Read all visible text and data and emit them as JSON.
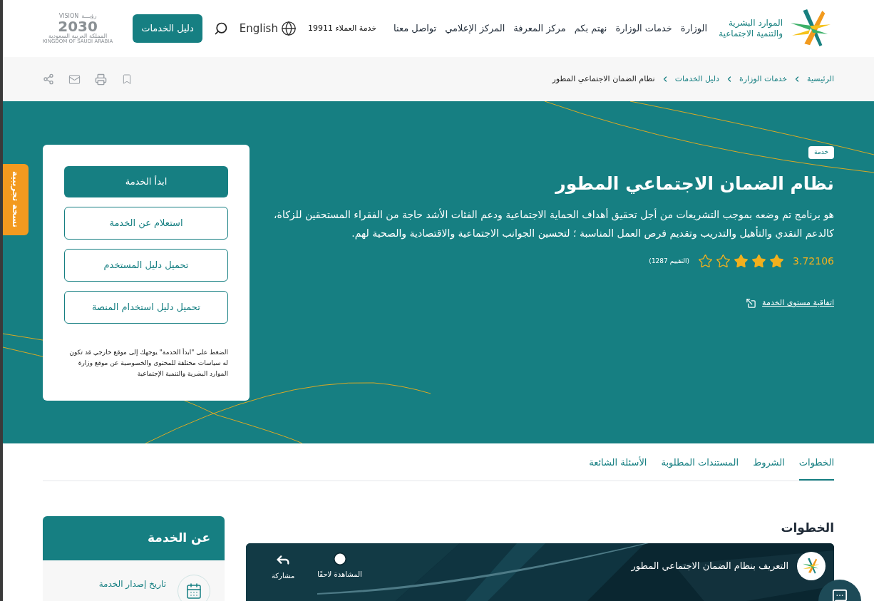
{
  "header": {
    "logo_text": [
      "الموارد البشرية",
      "والتنمية الاجتماعية"
    ],
    "nav": [
      {
        "label": "الوزارة"
      },
      {
        "label": "خدمات الوزارة"
      },
      {
        "label": "نهتم بكم"
      },
      {
        "label": "مركز المعرفة"
      },
      {
        "label": "المركز الإعلامي"
      },
      {
        "label": "تواصل معنا"
      }
    ],
    "customer_service": "خدمة العملاء 19911",
    "language": "English",
    "guide_button": "دليل الخدمات",
    "vision": {
      "top_en": "VISION",
      "top_ar": "رؤيـــة",
      "year": "2030",
      "line_ar": "المملكة العربية السعودية",
      "line_en": "KINGDOM OF SAUDI ARABIA"
    }
  },
  "breadcrumb": [
    {
      "label": "الرئيسية",
      "current": false
    },
    {
      "label": "خدمات الوزارة",
      "current": false
    },
    {
      "label": "دليل الخدمات",
      "current": false
    },
    {
      "label": "نظام الضمان الاجتماعي المطور",
      "current": true
    }
  ],
  "beta_tab": "نسخة تجريبية",
  "hero": {
    "badge": "خدمة",
    "title": "نظام الضمان الاجتماعي المطور",
    "description": "هو برنامج تم وضعه بموجب التشريعات من أجل تحقيق أهداف الحماية الاجتماعية ودعم الفئات الأشد حاجة من الفقراء المستحقين للزكاة، كالدعم النقدي والتأهيل والتدريب وتقديم فرص العمل المناسبة ؛ لتحسين الجوانب الاجتماعية والاقتصادية والصحية لهم.",
    "rating": {
      "value": "3.72106",
      "stars": 3,
      "count": "(التقييم 1287)"
    },
    "sla_link": "اتفاقية مستوى الخدمة"
  },
  "actions": {
    "buttons": [
      {
        "label": "ابدأ الخدمة",
        "kind": "primary"
      },
      {
        "label": "استعلام عن الخدمة",
        "kind": "outline"
      },
      {
        "label": "تحميل دليل المستخدم",
        "kind": "outline"
      },
      {
        "label": "تحميل دليل استخدام المنصة",
        "kind": "outline"
      }
    ],
    "note": "الضغط على \"ابدأ الخدمة\" يوجهك إلى موقع خارجي قد تكون له سياسات مختلفة للمحتوى والخصوصية عن موقع وزارة الموارد البشرية والتنمية الإجتماعية"
  },
  "tabs": [
    {
      "label": "الخطوات",
      "selected": true
    },
    {
      "label": "الشروط",
      "selected": false
    },
    {
      "label": "المستندات المطلوبة",
      "selected": false
    },
    {
      "label": "الأسئلة الشائعة",
      "selected": false
    }
  ],
  "steps_heading": "الخطوات",
  "video": {
    "title": "التعريف بنظام الضمان الاجتماعي المطور",
    "watch_later": "المشاهدة لاحقًا",
    "share": "مشاركة"
  },
  "about": {
    "title": "عن الخدمة",
    "items": [
      {
        "label": "تاريخ إصدار الخدمة"
      }
    ]
  }
}
